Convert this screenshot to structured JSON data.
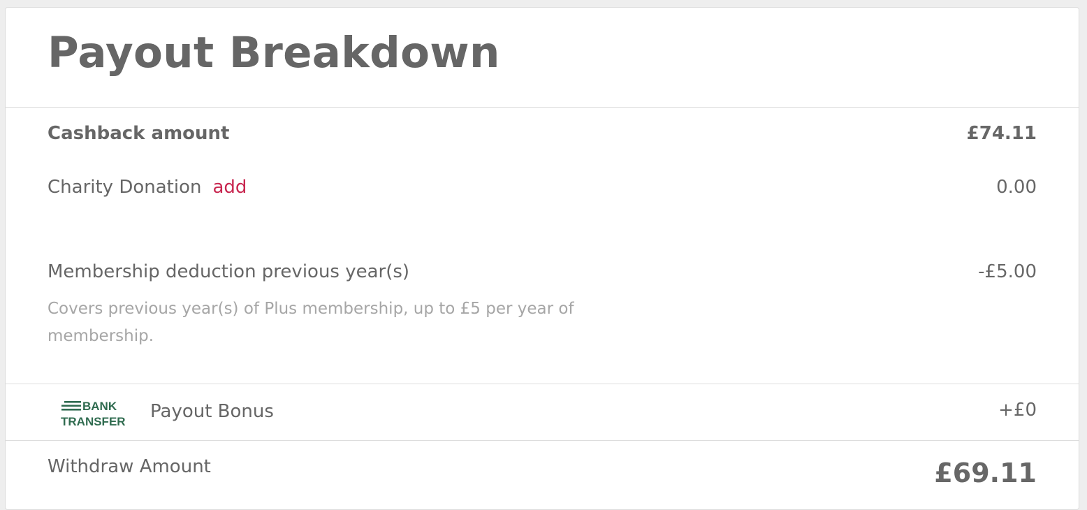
{
  "title": "Payout Breakdown",
  "rows": {
    "cashback": {
      "label": "Cashback amount",
      "value": "£74.11"
    },
    "charity": {
      "label": "Charity Donation",
      "link": "add",
      "value": "0.00"
    },
    "membership": {
      "label": "Membership deduction previous year(s)",
      "value": "-£5.00",
      "note": "Covers previous year(s) of Plus membership, up to £5 per year of membership."
    },
    "bonus": {
      "logo_line1": "BANK",
      "logo_line2": "TRANSFER",
      "label": "Payout Bonus",
      "value": "+£0"
    },
    "withdraw": {
      "label": "Withdraw Amount",
      "value": "£69.11"
    }
  },
  "colors": {
    "accent_link": "#c8264f",
    "bank_logo": "#2f6b4f",
    "text": "#666666",
    "muted": "#a6a6a6"
  },
  "icons": {
    "bank": "bank-transfer-logo"
  }
}
